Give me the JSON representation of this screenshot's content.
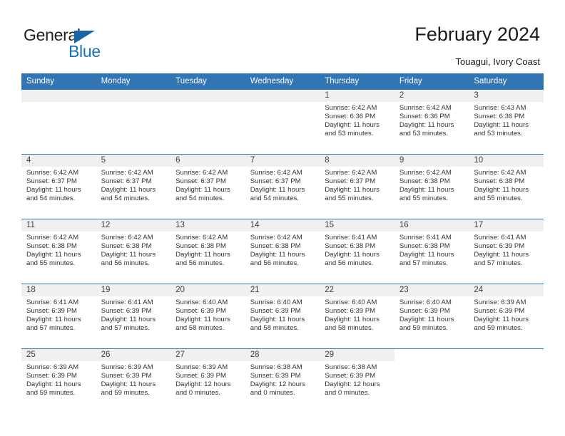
{
  "brand": {
    "name_part1": "General",
    "name_part2": "Blue",
    "triangle_color": "#1565a8",
    "blue_color": "#1971b8"
  },
  "header": {
    "title": "February 2024",
    "subtitle": "Touagui, Ivory Coast",
    "header_bg": "#3275b5",
    "daynum_bg": "#f0f0f0"
  },
  "weekdays": [
    "Sunday",
    "Monday",
    "Tuesday",
    "Wednesday",
    "Thursday",
    "Friday",
    "Saturday"
  ],
  "labels": {
    "sunrise_prefix": "Sunrise:",
    "sunset_prefix": "Sunset:",
    "daylight_prefix": "Daylight:"
  },
  "weeks": [
    [
      {
        "day": "",
        "empty": true
      },
      {
        "day": "",
        "empty": true
      },
      {
        "day": "",
        "empty": true
      },
      {
        "day": "",
        "empty": true
      },
      {
        "day": "1",
        "sunrise": "Sunrise: 6:42 AM",
        "sunset": "Sunset: 6:36 PM",
        "daylight_line1": "Daylight: 11 hours",
        "daylight_line2": "and 53 minutes."
      },
      {
        "day": "2",
        "sunrise": "Sunrise: 6:42 AM",
        "sunset": "Sunset: 6:36 PM",
        "daylight_line1": "Daylight: 11 hours",
        "daylight_line2": "and 53 minutes."
      },
      {
        "day": "3",
        "sunrise": "Sunrise: 6:43 AM",
        "sunset": "Sunset: 6:36 PM",
        "daylight_line1": "Daylight: 11 hours",
        "daylight_line2": "and 53 minutes."
      }
    ],
    [
      {
        "day": "4",
        "sunrise": "Sunrise: 6:42 AM",
        "sunset": "Sunset: 6:37 PM",
        "daylight_line1": "Daylight: 11 hours",
        "daylight_line2": "and 54 minutes."
      },
      {
        "day": "5",
        "sunrise": "Sunrise: 6:42 AM",
        "sunset": "Sunset: 6:37 PM",
        "daylight_line1": "Daylight: 11 hours",
        "daylight_line2": "and 54 minutes."
      },
      {
        "day": "6",
        "sunrise": "Sunrise: 6:42 AM",
        "sunset": "Sunset: 6:37 PM",
        "daylight_line1": "Daylight: 11 hours",
        "daylight_line2": "and 54 minutes."
      },
      {
        "day": "7",
        "sunrise": "Sunrise: 6:42 AM",
        "sunset": "Sunset: 6:37 PM",
        "daylight_line1": "Daylight: 11 hours",
        "daylight_line2": "and 54 minutes."
      },
      {
        "day": "8",
        "sunrise": "Sunrise: 6:42 AM",
        "sunset": "Sunset: 6:37 PM",
        "daylight_line1": "Daylight: 11 hours",
        "daylight_line2": "and 55 minutes."
      },
      {
        "day": "9",
        "sunrise": "Sunrise: 6:42 AM",
        "sunset": "Sunset: 6:38 PM",
        "daylight_line1": "Daylight: 11 hours",
        "daylight_line2": "and 55 minutes."
      },
      {
        "day": "10",
        "sunrise": "Sunrise: 6:42 AM",
        "sunset": "Sunset: 6:38 PM",
        "daylight_line1": "Daylight: 11 hours",
        "daylight_line2": "and 55 minutes."
      }
    ],
    [
      {
        "day": "11",
        "sunrise": "Sunrise: 6:42 AM",
        "sunset": "Sunset: 6:38 PM",
        "daylight_line1": "Daylight: 11 hours",
        "daylight_line2": "and 55 minutes."
      },
      {
        "day": "12",
        "sunrise": "Sunrise: 6:42 AM",
        "sunset": "Sunset: 6:38 PM",
        "daylight_line1": "Daylight: 11 hours",
        "daylight_line2": "and 56 minutes."
      },
      {
        "day": "13",
        "sunrise": "Sunrise: 6:42 AM",
        "sunset": "Sunset: 6:38 PM",
        "daylight_line1": "Daylight: 11 hours",
        "daylight_line2": "and 56 minutes."
      },
      {
        "day": "14",
        "sunrise": "Sunrise: 6:42 AM",
        "sunset": "Sunset: 6:38 PM",
        "daylight_line1": "Daylight: 11 hours",
        "daylight_line2": "and 56 minutes."
      },
      {
        "day": "15",
        "sunrise": "Sunrise: 6:41 AM",
        "sunset": "Sunset: 6:38 PM",
        "daylight_line1": "Daylight: 11 hours",
        "daylight_line2": "and 56 minutes."
      },
      {
        "day": "16",
        "sunrise": "Sunrise: 6:41 AM",
        "sunset": "Sunset: 6:38 PM",
        "daylight_line1": "Daylight: 11 hours",
        "daylight_line2": "and 57 minutes."
      },
      {
        "day": "17",
        "sunrise": "Sunrise: 6:41 AM",
        "sunset": "Sunset: 6:39 PM",
        "daylight_line1": "Daylight: 11 hours",
        "daylight_line2": "and 57 minutes."
      }
    ],
    [
      {
        "day": "18",
        "sunrise": "Sunrise: 6:41 AM",
        "sunset": "Sunset: 6:39 PM",
        "daylight_line1": "Daylight: 11 hours",
        "daylight_line2": "and 57 minutes."
      },
      {
        "day": "19",
        "sunrise": "Sunrise: 6:41 AM",
        "sunset": "Sunset: 6:39 PM",
        "daylight_line1": "Daylight: 11 hours",
        "daylight_line2": "and 57 minutes."
      },
      {
        "day": "20",
        "sunrise": "Sunrise: 6:40 AM",
        "sunset": "Sunset: 6:39 PM",
        "daylight_line1": "Daylight: 11 hours",
        "daylight_line2": "and 58 minutes."
      },
      {
        "day": "21",
        "sunrise": "Sunrise: 6:40 AM",
        "sunset": "Sunset: 6:39 PM",
        "daylight_line1": "Daylight: 11 hours",
        "daylight_line2": "and 58 minutes."
      },
      {
        "day": "22",
        "sunrise": "Sunrise: 6:40 AM",
        "sunset": "Sunset: 6:39 PM",
        "daylight_line1": "Daylight: 11 hours",
        "daylight_line2": "and 58 minutes."
      },
      {
        "day": "23",
        "sunrise": "Sunrise: 6:40 AM",
        "sunset": "Sunset: 6:39 PM",
        "daylight_line1": "Daylight: 11 hours",
        "daylight_line2": "and 59 minutes."
      },
      {
        "day": "24",
        "sunrise": "Sunrise: 6:39 AM",
        "sunset": "Sunset: 6:39 PM",
        "daylight_line1": "Daylight: 11 hours",
        "daylight_line2": "and 59 minutes."
      }
    ],
    [
      {
        "day": "25",
        "sunrise": "Sunrise: 6:39 AM",
        "sunset": "Sunset: 6:39 PM",
        "daylight_line1": "Daylight: 11 hours",
        "daylight_line2": "and 59 minutes."
      },
      {
        "day": "26",
        "sunrise": "Sunrise: 6:39 AM",
        "sunset": "Sunset: 6:39 PM",
        "daylight_line1": "Daylight: 11 hours",
        "daylight_line2": "and 59 minutes."
      },
      {
        "day": "27",
        "sunrise": "Sunrise: 6:39 AM",
        "sunset": "Sunset: 6:39 PM",
        "daylight_line1": "Daylight: 12 hours",
        "daylight_line2": "and 0 minutes."
      },
      {
        "day": "28",
        "sunrise": "Sunrise: 6:38 AM",
        "sunset": "Sunset: 6:39 PM",
        "daylight_line1": "Daylight: 12 hours",
        "daylight_line2": "and 0 minutes."
      },
      {
        "day": "29",
        "sunrise": "Sunrise: 6:38 AM",
        "sunset": "Sunset: 6:39 PM",
        "daylight_line1": "Daylight: 12 hours",
        "daylight_line2": "and 0 minutes."
      },
      {
        "day": "",
        "empty": true
      },
      {
        "day": "",
        "empty": true
      }
    ]
  ]
}
